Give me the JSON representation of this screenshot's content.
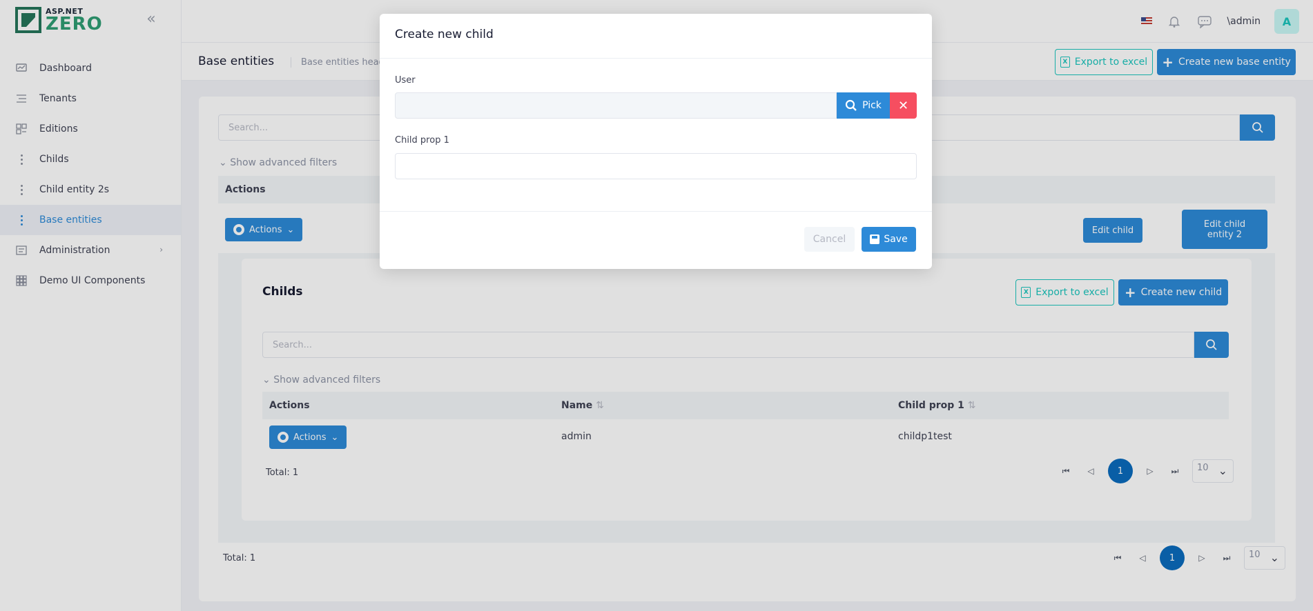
{
  "brand": {
    "small": "ASP.NET",
    "big": "ZERO"
  },
  "sidebar": {
    "items": [
      {
        "label": "Dashboard",
        "icon": "dashboard-icon"
      },
      {
        "label": "Tenants",
        "icon": "list-icon"
      },
      {
        "label": "Editions",
        "icon": "grid-icon"
      },
      {
        "label": "Childs",
        "icon": "vertical-dots-icon"
      },
      {
        "label": "Child entity 2s",
        "icon": "vertical-dots-icon"
      },
      {
        "label": "Base entities",
        "icon": "vertical-dots-icon",
        "active": true
      },
      {
        "label": "Administration",
        "icon": "admin-icon",
        "has_submenu": true
      },
      {
        "label": "Demo UI Components",
        "icon": "components-icon"
      }
    ]
  },
  "header": {
    "user": "\\admin",
    "avatar_letter": "A"
  },
  "subheader": {
    "title": "Base entities",
    "description": "Base entities heade",
    "export_label": "Export to excel",
    "create_label": "Create new base entity"
  },
  "main": {
    "search_placeholder": "Search...",
    "advanced_filters": "Show advanced filters",
    "actions_header": "Actions",
    "actions_button": "Actions",
    "edit_child": "Edit child",
    "edit_child_entity2": "Edit child entity 2",
    "total": "Total: 1",
    "page": "1",
    "page_size": "10"
  },
  "childs": {
    "title": "Childs",
    "export_label": "Export to excel",
    "create_label": "Create new child",
    "search_placeholder": "Search...",
    "advanced_filters": "Show advanced filters",
    "columns": [
      "Actions",
      "Name",
      "Child prop 1"
    ],
    "rows": [
      {
        "actions": "Actions",
        "name": "admin",
        "child_prop_1": "childp1test"
      }
    ],
    "total": "Total: 1",
    "page": "1",
    "page_size": "10"
  },
  "modal": {
    "title": "Create new child",
    "user_label": "User",
    "user_value": "",
    "pick_label": "Pick",
    "child_prop_label": "Child prop 1",
    "child_prop_value": "",
    "cancel_label": "Cancel",
    "save_label": "Save"
  },
  "colors": {
    "primary": "#2d8ad8",
    "success_outline": "#1bc5bd",
    "danger": "#f64e60",
    "brand_green": "#2f9e74"
  }
}
